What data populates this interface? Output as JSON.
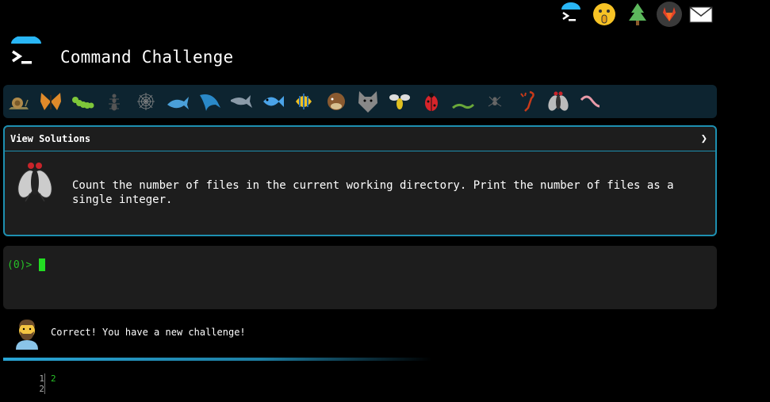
{
  "header": {
    "title": "Command Challenge"
  },
  "top_icons": [
    "terminal-umbrella-icon",
    "shushing-face-icon",
    "tree-icon",
    "gitlab-icon",
    "mail-icon"
  ],
  "creatures": [
    "snail",
    "butterfly",
    "caterpillar",
    "ant",
    "spider-web",
    "whale",
    "dolphin-a",
    "dolphin-b",
    "fish",
    "tropical-fish",
    "blowfish",
    "wolf",
    "bee",
    "ladybug",
    "worm",
    "spider",
    "scorpion",
    "fly",
    "earthworm"
  ],
  "panel": {
    "header_label": "View Solutions",
    "chevron": "❯",
    "challenge_text": "Count the number of files in the current working directory. Print the number of files as a single integer."
  },
  "terminal": {
    "prompt": "(0)>"
  },
  "feedback": {
    "message": "Correct! You have a new challenge!",
    "progress": 0.56
  },
  "output": {
    "line_numbers": [
      "1",
      "2"
    ],
    "lines": [
      "2",
      ""
    ]
  },
  "colors": {
    "accent": "#1e8fb0",
    "prompt_green": "#27c227",
    "panel_bg": "#1d1d1d"
  }
}
